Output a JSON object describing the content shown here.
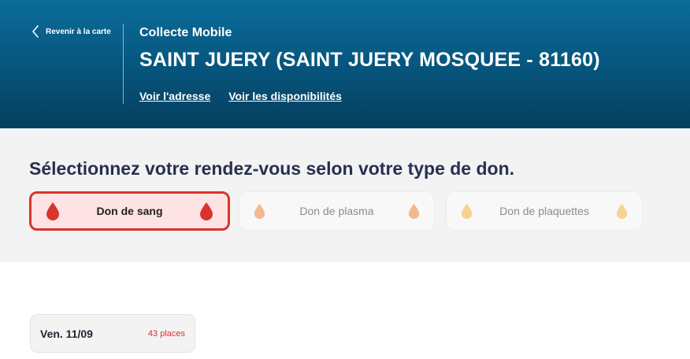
{
  "header": {
    "back_label": "Revenir à la carte",
    "subtitle": "Collecte Mobile",
    "title": "SAINT JUERY (SAINT JUERY MOSQUEE - 81160)",
    "links": [
      {
        "label": "Voir l'adresse"
      },
      {
        "label": "Voir les disponibilités"
      }
    ]
  },
  "selection": {
    "heading": "Sélectionnez votre rendez-vous selon votre type de don.",
    "types": [
      {
        "label": "Don de sang",
        "selected": true,
        "icon": "blood-drop-icon",
        "color": "#d9342b"
      },
      {
        "label": "Don de plasma",
        "selected": false,
        "icon": "plasma-drop-icon",
        "color": "#f2b98f"
      },
      {
        "label": "Don de plaquettes",
        "selected": false,
        "icon": "platelet-drop-icon",
        "color": "#f6d38f"
      }
    ]
  },
  "dates": [
    {
      "date": "Ven. 11/09",
      "places": "43 places"
    }
  ],
  "colors": {
    "header_top": "#0b6c9a",
    "header_bottom": "#053f5f",
    "accent_red": "#d9342b",
    "heading_navy": "#27304f"
  }
}
